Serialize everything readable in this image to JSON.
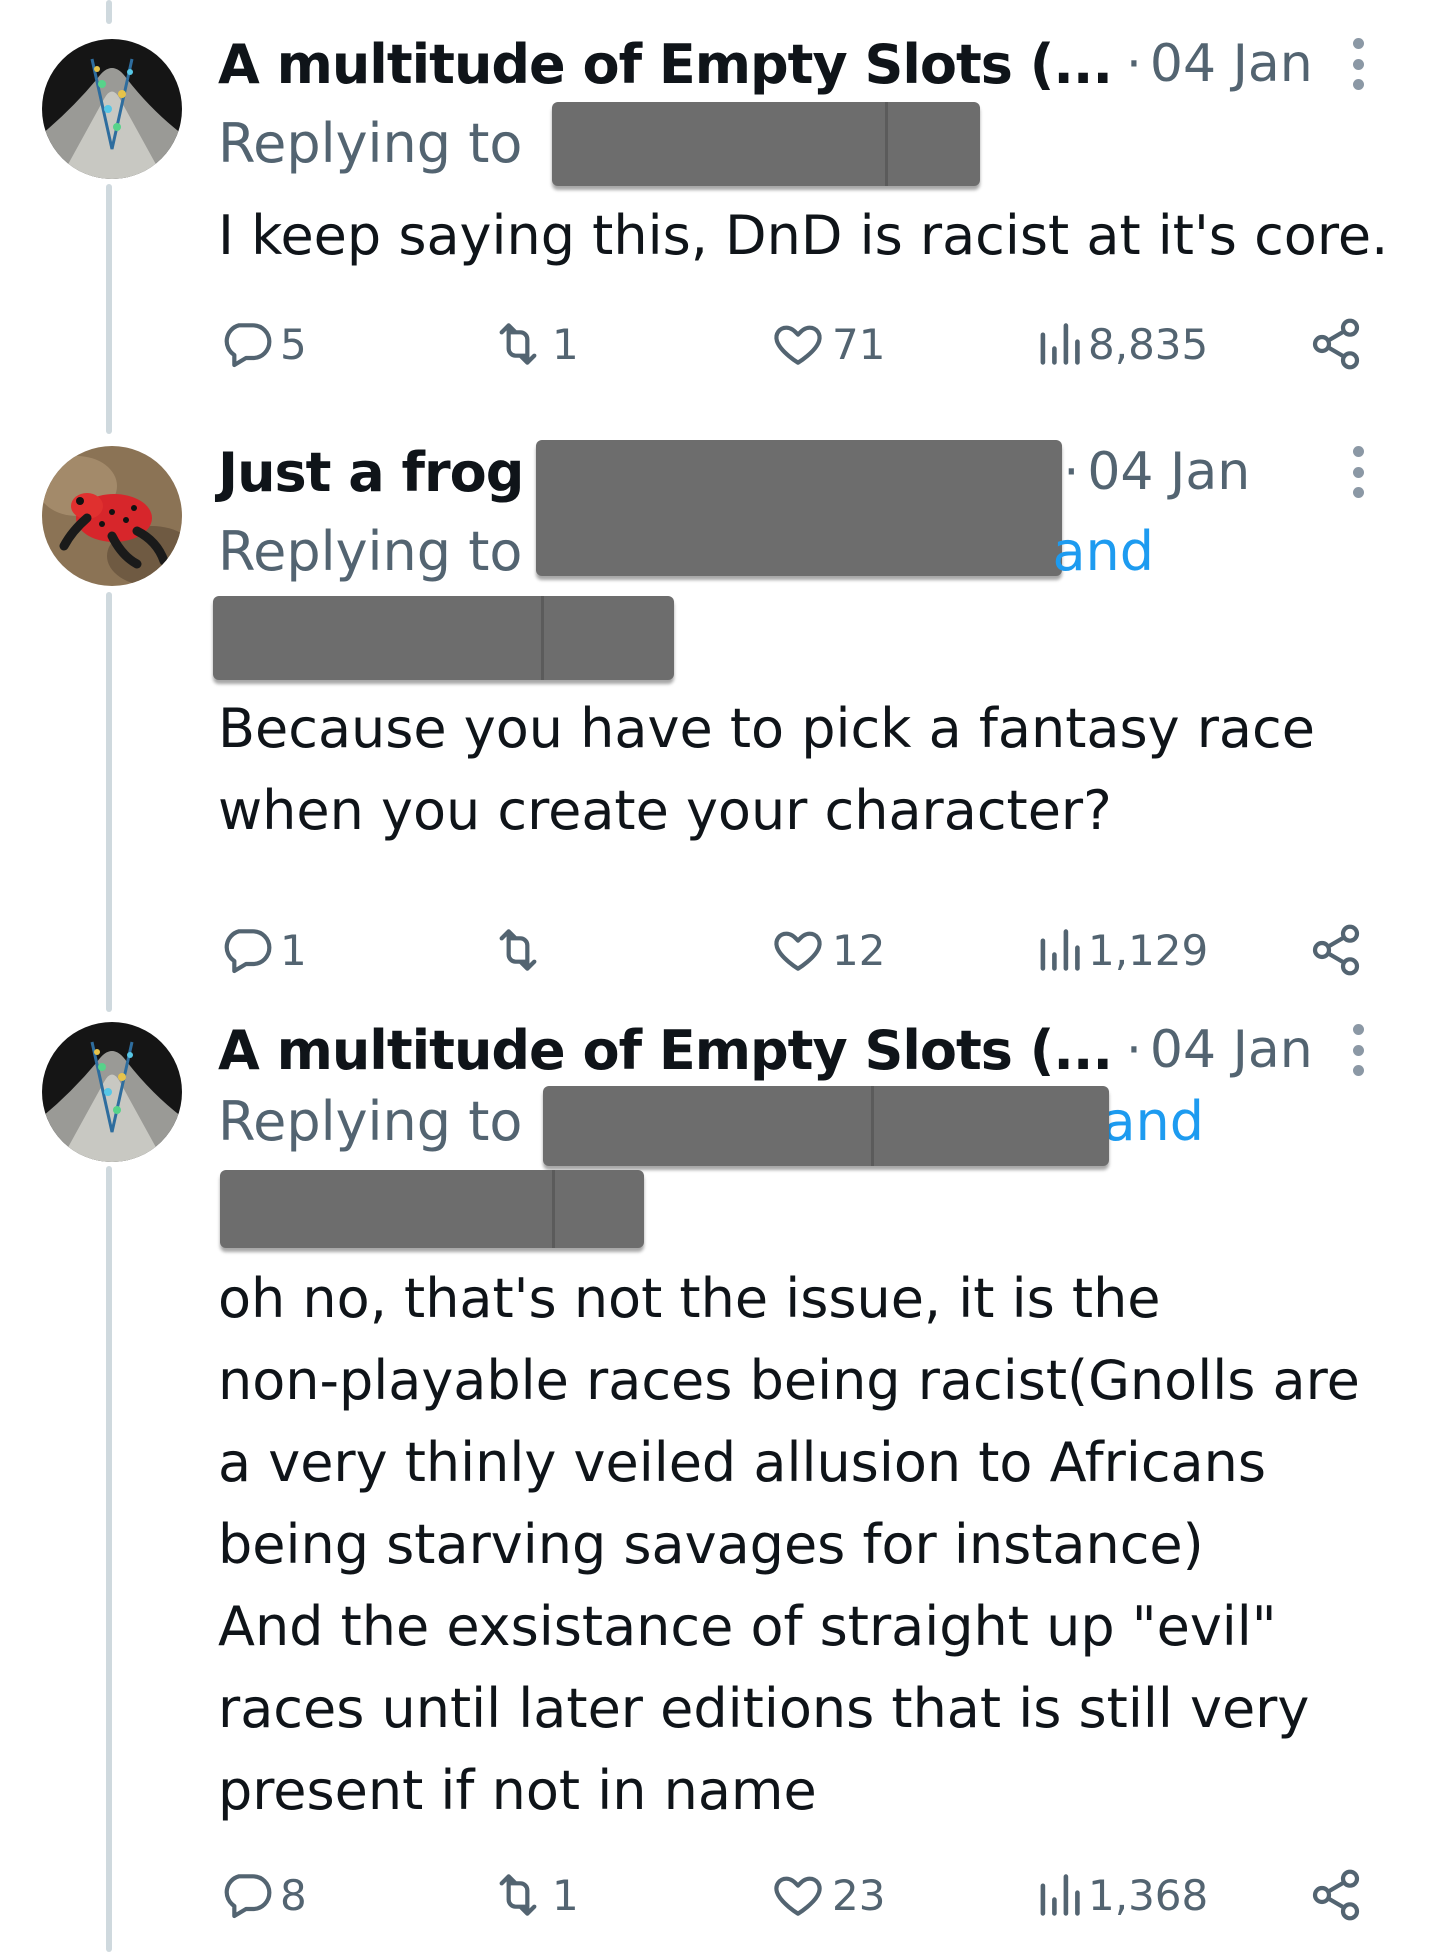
{
  "tweets": [
    {
      "author": "A multitude of Empty Slots (...",
      "separator": "·",
      "date": "04 Jan",
      "replying_label": "Replying to",
      "and_label": "",
      "text": "I keep saying this, DnD is racist at it's core.",
      "stats": {
        "replies": "5",
        "retweets": "1",
        "likes": "71",
        "views": "8,835"
      },
      "avatar": "constellation-avatar"
    },
    {
      "author": "Just a frog",
      "separator": "·",
      "date": "04 Jan",
      "replying_label": "Replying to",
      "and_label": "and",
      "text": "Because you have to pick a fantasy race\nwhen you create your character?",
      "stats": {
        "replies": "1",
        "retweets": "",
        "likes": "12",
        "views": "1,129"
      },
      "avatar": "red-frog-avatar"
    },
    {
      "author": "A multitude of Empty Slots (...",
      "separator": "·",
      "date": "04 Jan",
      "replying_label": "Replying to",
      "and_label": "and",
      "text": "oh no, that's not the issue, it is the\nnon-playable races being racist(Gnolls are\na very thinly veiled allusion to Africans\nbeing starving savages for instance)\nAnd the exsistance of straight up \"evil\"\nraces until later editions that is still very\npresent  if not in name",
      "stats": {
        "replies": "8",
        "retweets": "1",
        "likes": "23",
        "views": "1,368"
      },
      "avatar": "constellation-avatar"
    }
  ],
  "colors": {
    "text": "#0f1419",
    "muted": "#536471",
    "link": "#1d9bf0",
    "thread": "#cfd9de",
    "redaction": "#6d6d6d"
  },
  "icons": [
    "reply-icon",
    "retweet-icon",
    "like-icon",
    "views-icon",
    "share-icon",
    "more-icon"
  ]
}
